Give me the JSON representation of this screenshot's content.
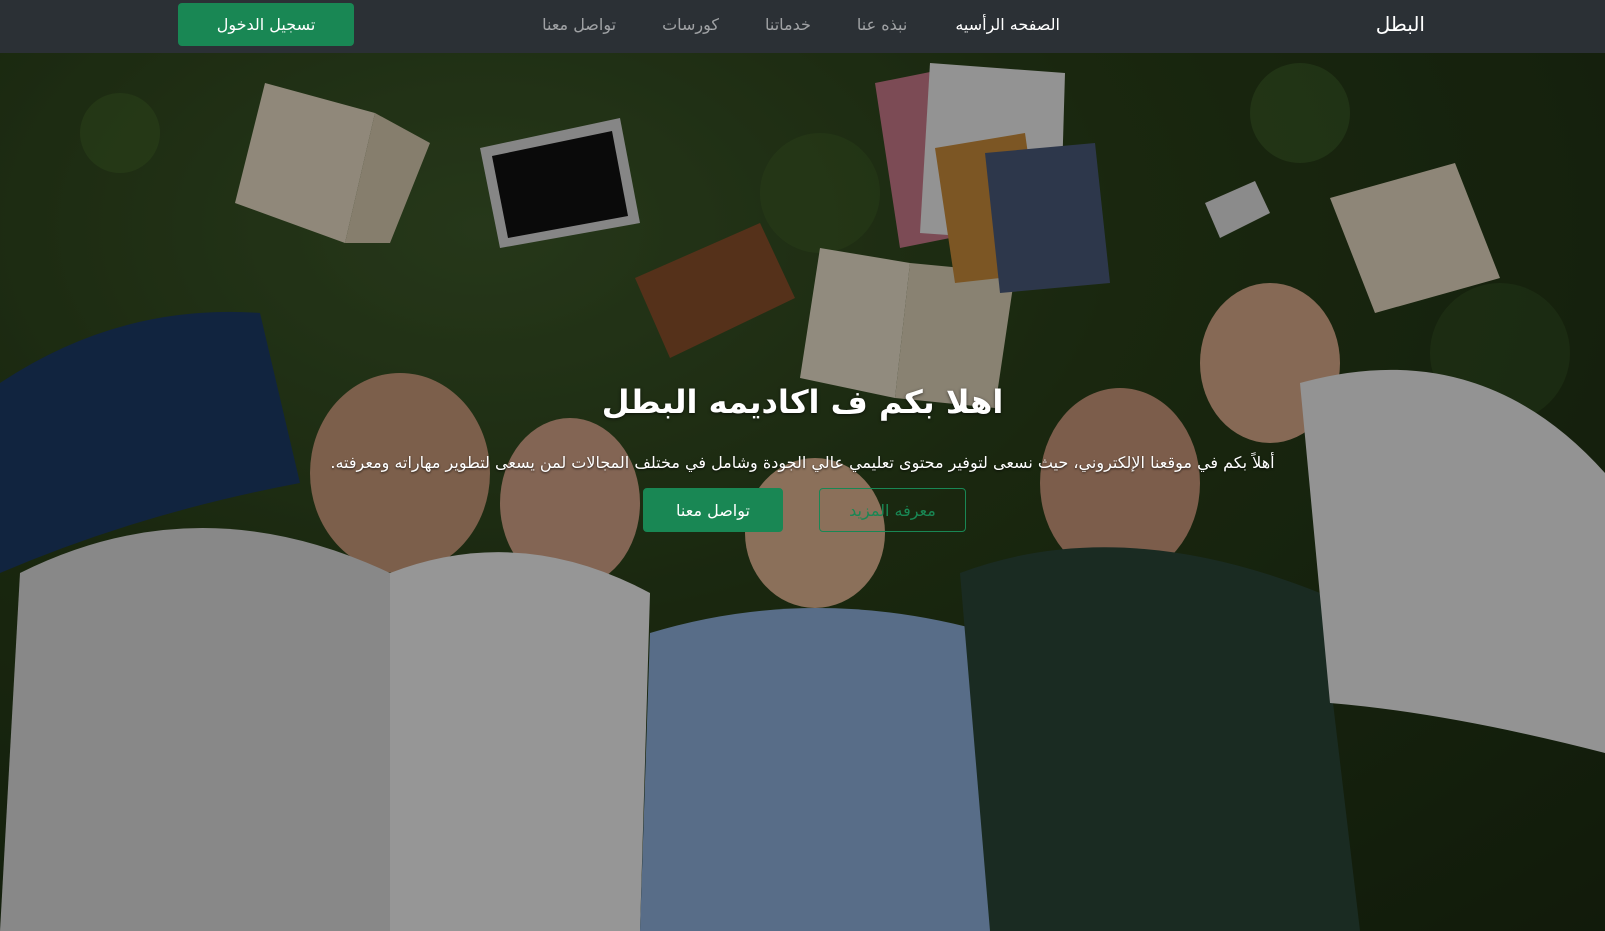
{
  "navbar": {
    "brand": "البطل",
    "links": [
      {
        "label": "الصفحه الرأسيه",
        "active": true
      },
      {
        "label": "نبذه عنا",
        "active": false
      },
      {
        "label": "خدماتنا",
        "active": false
      },
      {
        "label": "كورسات",
        "active": false
      },
      {
        "label": "تواصل معنا",
        "active": false
      }
    ],
    "login_label": "تسجيل الدخول"
  },
  "hero": {
    "title": "اهلا بكم ف اكاديمه البطل",
    "lead": "أهلاً بكم في موقعنا الإلكتروني، حيث نسعى لتوفير محتوى تعليمي عالي الجودة وشامل في مختلف المجالات لمن يسعى لتطوير مهاراته ومعرفته.",
    "primary_button": "تواصل معنا",
    "secondary_button": "معرفه المزيد",
    "background_image": "group-of-students-lying-on-grass-with-books"
  },
  "colors": {
    "navbar_bg": "#2b3035",
    "accent": "#198754",
    "text_light": "#ffffff",
    "nav_muted": "rgba(255,255,255,0.55)"
  }
}
